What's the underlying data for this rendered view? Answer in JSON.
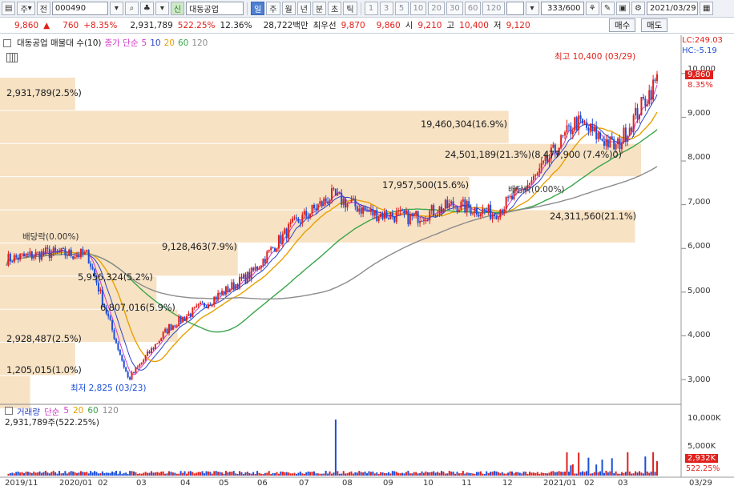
{
  "toolbar": {
    "market": "주",
    "prefix": "전",
    "code": "000490",
    "stock_badge": "신",
    "stock_name": "대동공업",
    "periods": [
      {
        "label": "일",
        "active": true
      },
      {
        "label": "주"
      },
      {
        "label": "월"
      },
      {
        "label": "년"
      },
      {
        "label": "분"
      },
      {
        "label": "초"
      },
      {
        "label": "틱"
      }
    ],
    "intervals": [
      "1",
      "3",
      "5",
      "10",
      "20",
      "30",
      "60",
      "120"
    ],
    "counter": "333",
    "counter_total": "/600",
    "date": "2021/03/29"
  },
  "quote": {
    "price": "9,860",
    "change": "760",
    "change_pct": "+8.35%",
    "volume": "2,931,789",
    "volume_pct": "522.25%",
    "turnover_pct": "12.36%",
    "amount": "28,722백만",
    "bid_label": "최우선",
    "ask_price": "9,870",
    "bid_price": "9,860",
    "open_label": "시",
    "open": "9,210",
    "high_label": "고",
    "high": "10,400",
    "low_label": "저",
    "low": "9,120",
    "buy": "매수",
    "sell": "매도"
  },
  "legend": {
    "title": "대동공업 매물대 수(10)",
    "ma_label": "종가 단순",
    "ma_periods": [
      "5",
      "10",
      "20",
      "60",
      "120"
    ],
    "lc": "LC:249.03",
    "hc": "HC:-5.19"
  },
  "annotations": {
    "high": "최고 10,400 (03/29)",
    "low": "최저 2,825 (03/23)",
    "dividend_1": "배당락(0.00%)",
    "dividend_2": "배당락(0.00%)"
  },
  "volume_profile": [
    {
      "label": "2,931,789(2.5%)"
    },
    {
      "label": "19,460,304(16.9%)"
    },
    {
      "label": "24,501,189(21.3%)(8,477,900 (7.4%)0)"
    },
    {
      "label": "17,957,500(15.6%)"
    },
    {
      "label": "24,311,560(21.1%)"
    },
    {
      "label": "9,128,463(7.9%)"
    },
    {
      "label": "5,956,324(5.2%)"
    },
    {
      "label": "6,807,016(5.9%)"
    },
    {
      "label": "2,928,487(2.5%)"
    },
    {
      "label": "1,205,015(1.0%)"
    }
  ],
  "price_axis": [
    "10,000",
    "9,000",
    "8,000",
    "7,000",
    "6,000",
    "5,000",
    "4,000",
    "3,000"
  ],
  "price_tags": {
    "current": "9,860",
    "pct": "8.35%"
  },
  "volume_legend": {
    "label": "거래량",
    "ma_label": "단순",
    "ma_periods": [
      "5",
      "20",
      "60",
      "120"
    ],
    "sub": "2,931,789주(522.25%)"
  },
  "volume_axis": [
    "10,000K",
    "5,000K"
  ],
  "volume_tags": {
    "current": "2,932K",
    "pct": "522.25%"
  },
  "x_axis": [
    "2019/11",
    "2020/01",
    "02",
    "03",
    "04",
    "05",
    "06",
    "07",
    "08",
    "09",
    "10",
    "11",
    "12",
    "2021/01",
    "02",
    "03",
    "03/29"
  ],
  "colors": {
    "up": "#e0201b",
    "down": "#1c4fd8",
    "ma5": "#d23cc8",
    "ma10": "#2a43c8",
    "ma20": "#e8a000",
    "ma60": "#3aa54a",
    "ma120": "#8c8c8c",
    "profile": "#f7e2c4"
  },
  "chart_data": {
    "type": "candlestick",
    "title": "대동공업 매물대 수(10)",
    "x": [
      "2019/11",
      "2020/01",
      "02",
      "03",
      "04",
      "05",
      "06",
      "07",
      "08",
      "09",
      "10",
      "11",
      "12",
      "2021/01",
      "02",
      "03",
      "03/29"
    ],
    "close": [
      5750,
      5900,
      5850,
      3000,
      4200,
      4800,
      5400,
      6500,
      7200,
      6800,
      6700,
      7000,
      6800,
      7600,
      8900,
      8300,
      9860
    ],
    "volume_profile_pct": [
      2.5,
      16.9,
      21.3,
      15.6,
      21.1,
      7.9,
      5.2,
      5.9,
      2.5,
      1.0
    ],
    "ylim": [
      2800,
      10400
    ]
  }
}
